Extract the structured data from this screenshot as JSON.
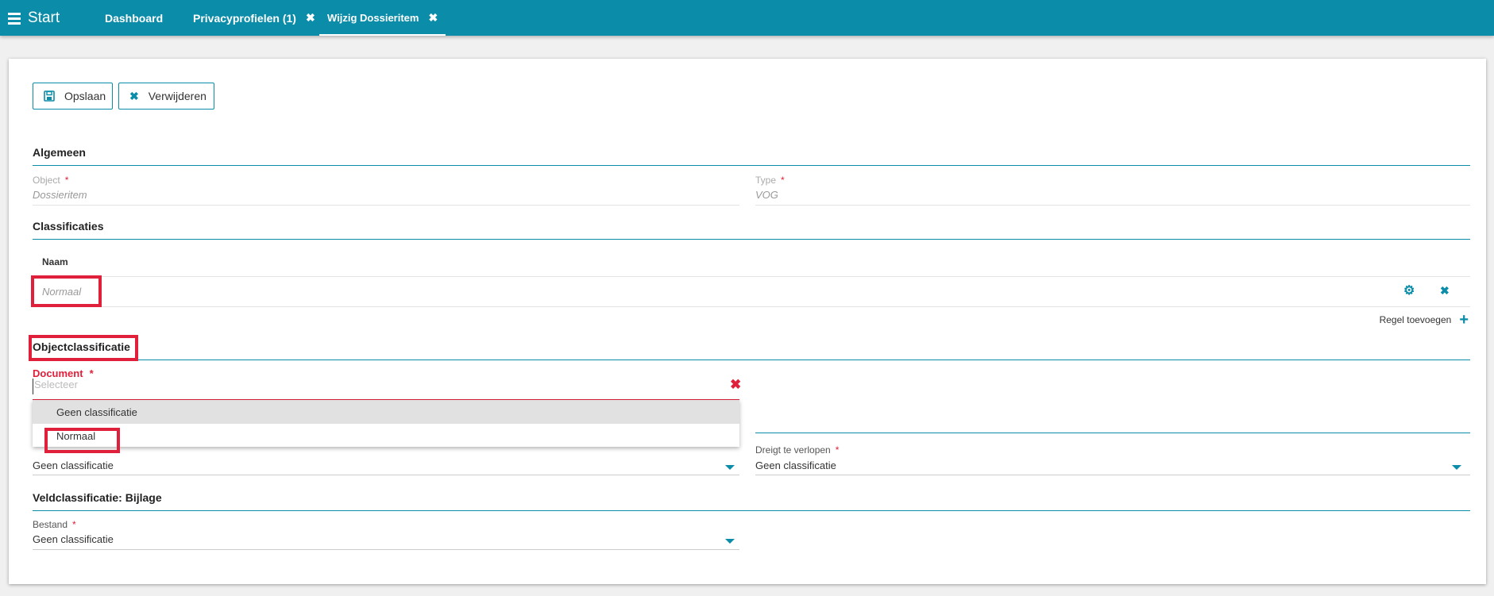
{
  "topbar": {
    "menu_label": "Start",
    "tabs": [
      {
        "label": "Dashboard"
      },
      {
        "label": "Privacyprofielen (1)",
        "close": "✖"
      },
      {
        "label": "Wijzig Dossieritem",
        "close": "✖"
      }
    ]
  },
  "toolbar": {
    "save_label": "Opslaan",
    "save_icon": "floppy-icon",
    "delete_label": "Verwijderen",
    "delete_icon": "cross-icon"
  },
  "algemeen": {
    "title": "Algemeen",
    "object_label": "Object",
    "object_value": "Dossieritem",
    "type_label": "Type",
    "type_value": "VOG",
    "required_mark": "*"
  },
  "classificaties": {
    "title": "Classificaties",
    "column_header": "Naam",
    "rows": [
      {
        "name": "Normaal"
      }
    ],
    "add_row_label": "Regel toevoegen"
  },
  "objectclassificatie": {
    "title": "Objectclassificatie",
    "document_label": "Document",
    "document_placeholder": "Selecteer",
    "required_mark": "*",
    "dropdown_options": [
      "Geen classificatie",
      "Normaal"
    ]
  },
  "retention": {
    "left_value": "Geen classificatie",
    "right_label": "Dreigt te verlopen",
    "right_value": "Geen classificatie"
  },
  "veldclassificatie": {
    "title": "Veldclassificatie: Bijlage",
    "bestand_label": "Bestand",
    "bestand_value": "Geen classificatie"
  },
  "colors": {
    "accent": "#0b8ca8",
    "error": "#e0203a",
    "highlight": "#e0203a"
  }
}
